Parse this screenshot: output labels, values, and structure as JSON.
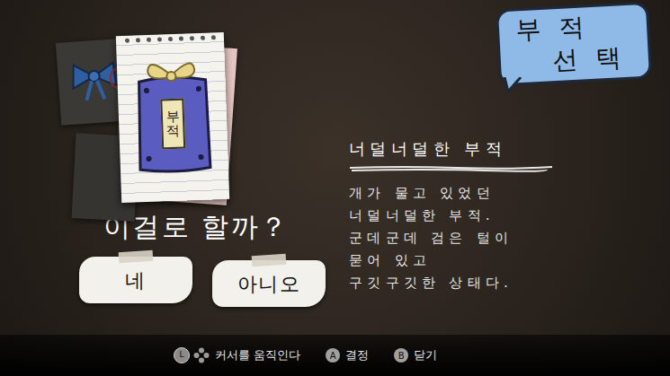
{
  "title": {
    "lines": [
      "부 적",
      "선 택"
    ]
  },
  "item": {
    "tag": "부적",
    "name": "너덜너덜한 부적",
    "description": [
      "개가 물고 있었던",
      "너덜너덜한 부적.",
      "군데군데 검은 털이",
      "묻어 있고",
      "구깃구깃한 상태다."
    ]
  },
  "prompt": {
    "question": "이걸로 할까？",
    "buttons": [
      {
        "label": "네",
        "selected": false
      },
      {
        "label": "아니오",
        "selected": false
      }
    ]
  },
  "hints": [
    {
      "kind": "stick",
      "key": "L",
      "label": "커서를 움직인다"
    },
    {
      "kind": "button",
      "key": "A",
      "label": "결정"
    },
    {
      "kind": "button",
      "key": "B",
      "label": "닫기"
    }
  ]
}
